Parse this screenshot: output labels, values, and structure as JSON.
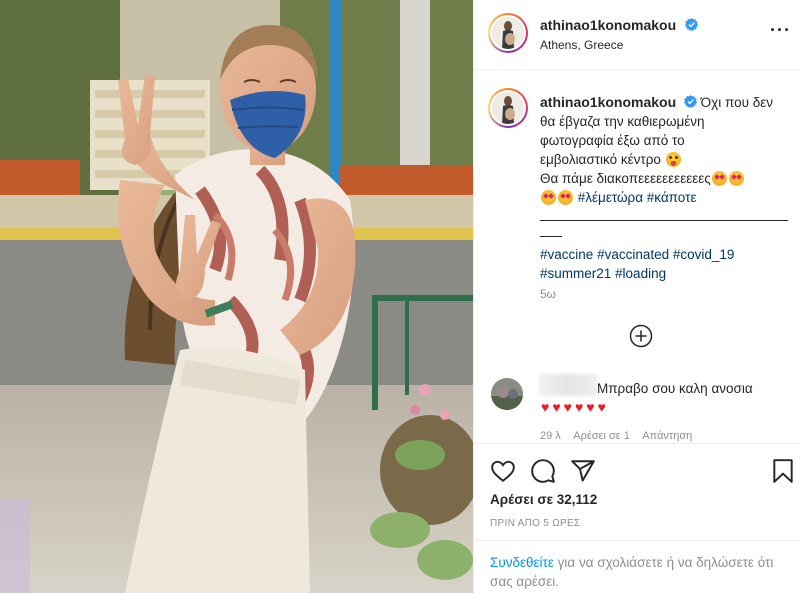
{
  "post": {
    "username": "athinao1konomakou",
    "location": "Athens, Greece",
    "more_icon": "more-horizontal-icon",
    "caption": {
      "username": "athinao1konomakou",
      "line1": "Όχι που δεν",
      "line2": "θα έβγαζα την καθιερωμένη",
      "line3": "φωτογραφία έξω από το",
      "line4": "εμβολιαστικό κέντρο",
      "line5": "Θα πάμε διακοπεεεεεεεεεεες",
      "tag_lemetora": "#λέμετώρα",
      "tag_kapote": "#κάποτε",
      "tags_line1": [
        "#vaccine",
        "#vaccinated",
        "#covid_19"
      ],
      "tags_line2": [
        "#summer21",
        "#loading"
      ]
    },
    "caption_time": "5ω"
  },
  "comment": {
    "text": "Μπραβο σου καλη ανοσια",
    "hearts": "♥♥♥♥♥♥",
    "time": "29 λ",
    "likes": "Αρέσει σε 1",
    "reply": "Απάντηση"
  },
  "actions": {
    "icons": [
      "heart-icon",
      "comment-icon",
      "share-icon",
      "bookmark-icon"
    ],
    "likes_text": "Αρέσει σε 32,112",
    "time_text": "ΠΡΙΝ ΑΠΟ 5 ΩΡΕΣ"
  },
  "login_prompt": {
    "link": "Συνδεθείτε",
    "text": " για να σχολιάσετε ή να δηλώσετε ότι σας αρέσει."
  },
  "colors": {
    "link_blue": "#0095f6",
    "tag_blue": "#00376b",
    "verified_blue": "#3897f0",
    "heart_red": "#ed1c24"
  }
}
